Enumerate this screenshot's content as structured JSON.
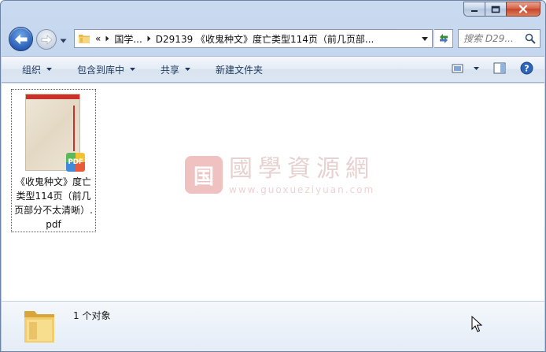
{
  "address": {
    "overflow": "«",
    "crumbs": [
      "国学...",
      "D29139 《收鬼种文》度亡类型114页（前几页部..."
    ]
  },
  "search": {
    "placeholder": "搜索 D29..."
  },
  "toolbar": {
    "organize": "组织",
    "include_in_library": "包含到库中",
    "share": "共享",
    "new_folder": "新建文件夹"
  },
  "file": {
    "name": "《收鬼种文》度亡类型114页（前几页部分不太清晰）.pdf",
    "badge": "PDF"
  },
  "watermark": {
    "title": "國學資源網",
    "url": "www.guoxueziyuan.com"
  },
  "details": {
    "count": "1 个对象"
  },
  "icons": {
    "back": "back-arrow-icon",
    "forward": "forward-arrow-icon",
    "refresh": "refresh-icon",
    "search": "search-icon",
    "help": "help-icon"
  },
  "colors": {
    "toolbar_text": "#1e395b",
    "close_button": "#c8452b",
    "back_button": "#2a5fb6"
  }
}
